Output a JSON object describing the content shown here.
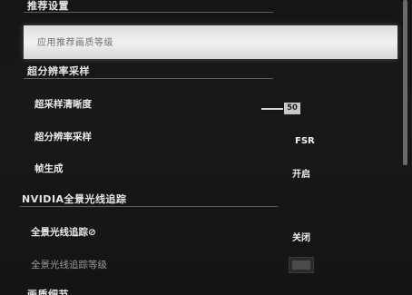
{
  "sections": {
    "recommend": {
      "title": "推荐设置"
    },
    "supersampling": {
      "title": "超分辨率采样"
    },
    "raytracing": {
      "title": "NVIDIA全景光线追踪"
    },
    "quality": {
      "title": "画质细节"
    }
  },
  "apply_button": {
    "label": "应用推荐画质等级"
  },
  "rows": {
    "sr_clarity": {
      "label": "超采样清晰度",
      "value": "50"
    },
    "sr_mode": {
      "label": "超分辨率采样",
      "value": "FSR"
    },
    "frame_gen": {
      "label": "帧生成",
      "value": "开启"
    },
    "pt": {
      "label": "全景光线追踪⊘",
      "value": "关闭"
    },
    "pt_level": {
      "label": "全景光线追踪等级"
    }
  }
}
